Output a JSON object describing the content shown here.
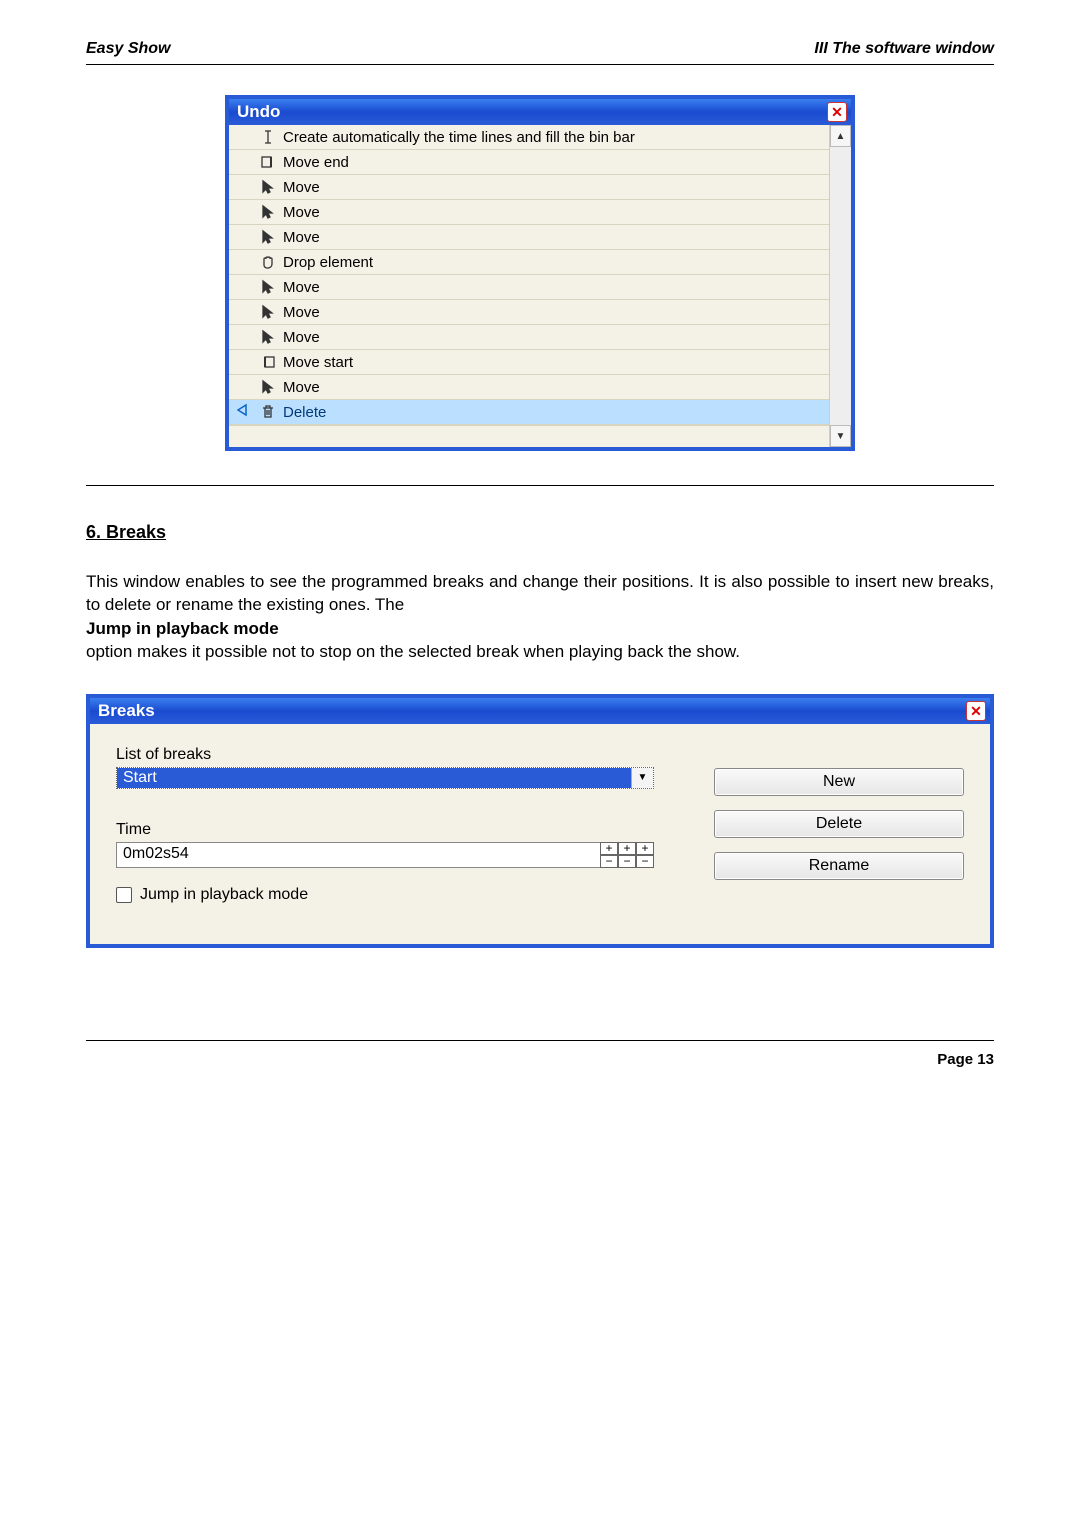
{
  "header": {
    "left": "Easy Show",
    "right": "III The software window"
  },
  "undo_window": {
    "title": "Undo",
    "rows": [
      {
        "icon": "text-cursor-icon",
        "label": "Create automatically the time lines and fill the bin bar",
        "selected": false
      },
      {
        "icon": "move-end-icon",
        "label": "Move end",
        "selected": false
      },
      {
        "icon": "cursor-icon",
        "label": "Move",
        "selected": false
      },
      {
        "icon": "cursor-icon",
        "label": "Move",
        "selected": false
      },
      {
        "icon": "cursor-icon",
        "label": "Move",
        "selected": false
      },
      {
        "icon": "hand-icon",
        "label": "Drop element",
        "selected": false
      },
      {
        "icon": "cursor-icon",
        "label": "Move",
        "selected": false
      },
      {
        "icon": "cursor-icon",
        "label": "Move",
        "selected": false
      },
      {
        "icon": "cursor-icon",
        "label": "Move",
        "selected": false
      },
      {
        "icon": "move-start-icon",
        "label": "Move start",
        "selected": false
      },
      {
        "icon": "cursor-icon",
        "label": "Move",
        "selected": false
      },
      {
        "icon": "trash-icon",
        "label": "Delete",
        "selected": true,
        "marker": true
      }
    ]
  },
  "section": {
    "heading": "6. Breaks",
    "p1": "This window enables to see the programmed breaks and change their positions. It is also possible to insert new breaks, to delete or rename the existing ones. The",
    "bold": "Jump in playback mode",
    "p2": " option makes it possible not to stop on the selected break when playing back the show."
  },
  "breaks_window": {
    "title": "Breaks",
    "list_label": "List of breaks",
    "selected_break": "Start",
    "time_label": "Time",
    "time_value": "0m02s54",
    "checkbox_label": "Jump in playback mode",
    "buttons": {
      "new": "New",
      "delete": "Delete",
      "rename": "Rename"
    }
  },
  "footer": {
    "page": "Page 13"
  }
}
